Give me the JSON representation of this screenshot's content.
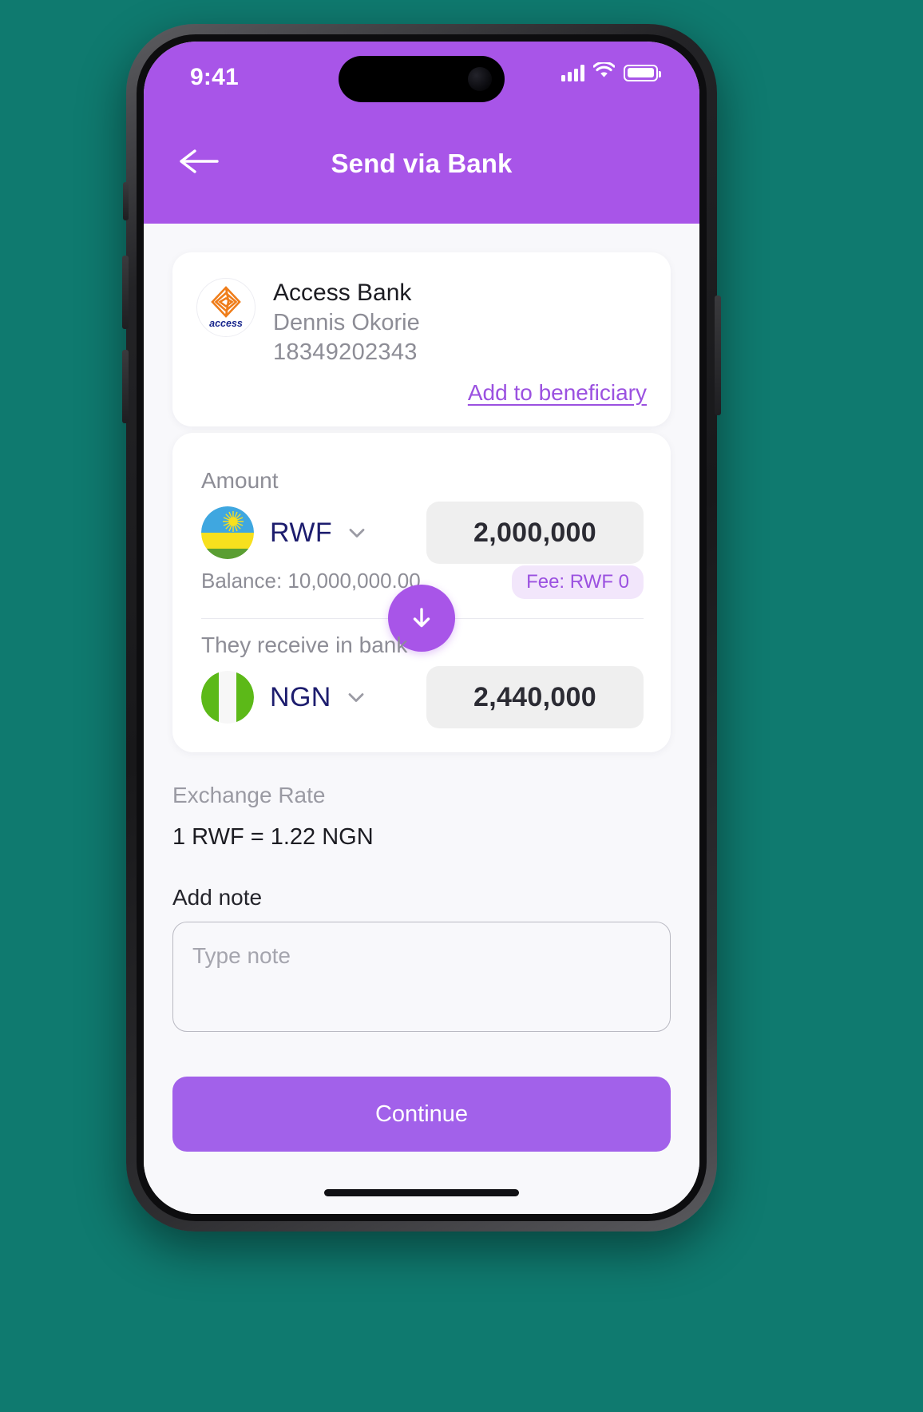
{
  "status_bar": {
    "time": "9:41",
    "signal_icon": "cellular-signal-icon",
    "wifi_icon": "wifi-icon",
    "battery_icon": "battery-icon"
  },
  "header": {
    "title": "Send via Bank",
    "back_icon": "arrow-left-icon",
    "background_color": "#a855e8"
  },
  "recipient": {
    "logo_label": "access",
    "bank_name": "Access Bank",
    "account_holder": "Dennis Okorie",
    "account_number": "18349202343",
    "add_beneficiary_label": "Add to beneficiary",
    "link_color": "#9b51e0"
  },
  "amount": {
    "label": "Amount",
    "send": {
      "flag": "rwanda-flag-icon",
      "currency": "RWF",
      "caret_icon": "chevron-down-icon",
      "value": "2,000,000"
    },
    "balance_text": "Balance: 10,000,000.00",
    "fee_badge": "Fee: RWF 0",
    "swap_icon": "arrow-down-icon",
    "receive_label": "They receive in bank",
    "receive": {
      "flag": "nigeria-flag-icon",
      "currency": "NGN",
      "caret_icon": "chevron-down-icon",
      "value": "2,440,000"
    }
  },
  "exchange_rate": {
    "label": "Exchange Rate",
    "value": "1 RWF = 1.22 NGN"
  },
  "note": {
    "label": "Add note",
    "placeholder": "Type note",
    "value": ""
  },
  "footer": {
    "continue_label": "Continue"
  }
}
